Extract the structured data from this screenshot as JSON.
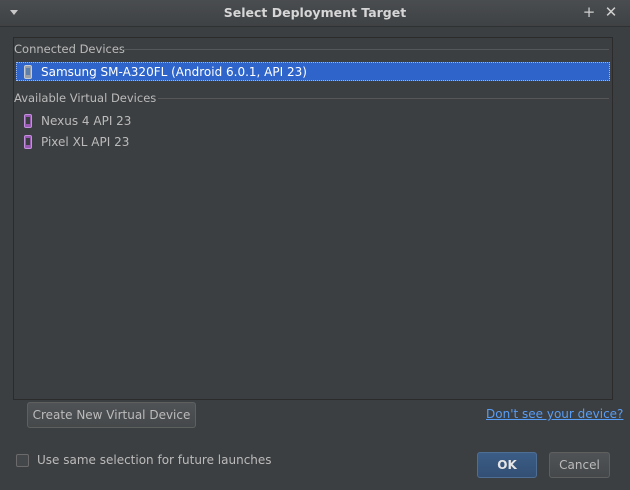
{
  "window": {
    "title": "Select Deployment Target",
    "menu_icon": "window-menu-arrow-icon",
    "pin_icon": "pin-plus-icon",
    "close_icon": "close-icon",
    "pin_glyph": "+",
    "close_glyph": "✕"
  },
  "groups": {
    "connected": {
      "label": "Connected Devices",
      "devices": [
        {
          "label": "Samsung SM-A320FL (Android 6.0.1, API 23)",
          "icon": "physical-device-icon",
          "selected": true
        }
      ]
    },
    "virtual": {
      "label": "Available Virtual Devices",
      "devices": [
        {
          "label": "Nexus 4 API 23",
          "icon": "virtual-device-icon",
          "selected": false
        },
        {
          "label": "Pixel XL API 23",
          "icon": "virtual-device-icon",
          "selected": false
        }
      ]
    }
  },
  "actions": {
    "create_label": "Create New Virtual Device",
    "help_link": "Don't see your device?",
    "remember_label": "Use same selection for future launches",
    "remember_checked": false,
    "ok_label": "OK",
    "cancel_label": "Cancel"
  },
  "colors": {
    "background": "#3c3f41",
    "selection": "#2f65ca",
    "link": "#589df6",
    "virtual_icon": "#9b59b6"
  }
}
